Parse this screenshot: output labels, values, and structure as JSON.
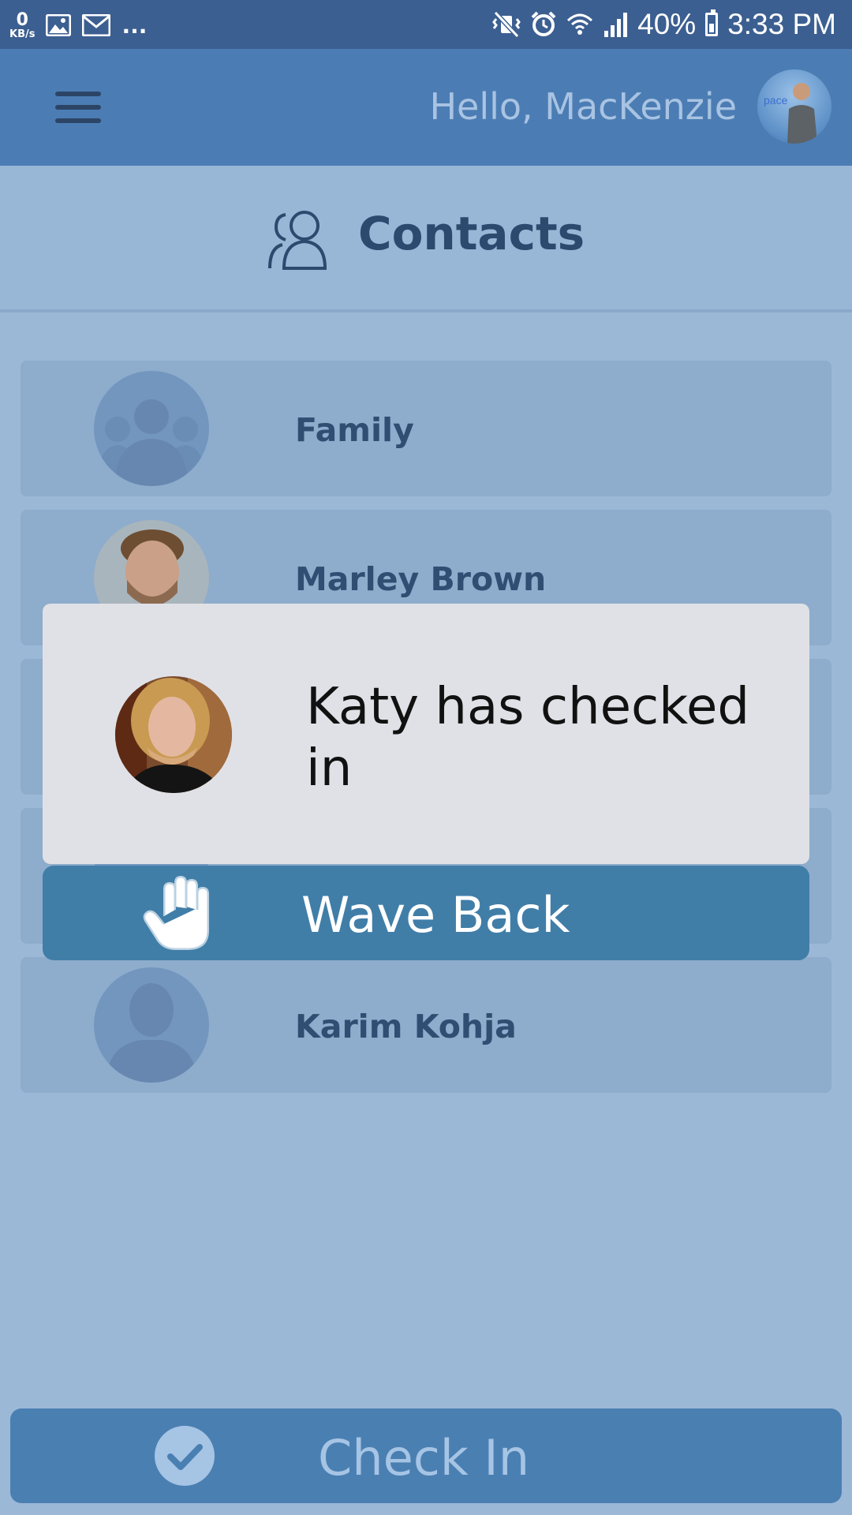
{
  "status_bar": {
    "net_speed_value": "0",
    "net_speed_unit": "KB/s",
    "more": "...",
    "battery": "40%",
    "time": "3:33 PM"
  },
  "header": {
    "greeting": "Hello, MacKenzie"
  },
  "page": {
    "title": "Contacts"
  },
  "contacts": [
    {
      "name": "Family"
    },
    {
      "name": "Marley Brown"
    },
    {
      "name": ""
    },
    {
      "name": ""
    },
    {
      "name": "Karim Kohja"
    }
  ],
  "popup": {
    "message": "Katy has checked in",
    "action_label": "Wave Back"
  },
  "footer": {
    "checkin_label": "Check In"
  },
  "colors": {
    "status_bar": "#3c5f91",
    "header": "#4b7db4",
    "background": "#9cb8d7",
    "wave_button": "#407ea8",
    "checkin_button": "#4a7fb2"
  }
}
